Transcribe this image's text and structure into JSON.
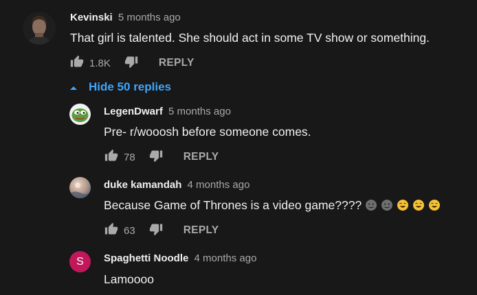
{
  "top_comment": {
    "author": "Kevinski",
    "time": "5 months ago",
    "text": "That girl is talented. She should act in some TV show or something.",
    "likes": "1.8K",
    "reply_label": "REPLY"
  },
  "replies_toggle": {
    "label": "Hide 50 replies"
  },
  "replies": [
    {
      "author": "LegenDwarf",
      "time": "5 months ago",
      "text": "Pre- r/wooosh before someone comes.",
      "likes": "78",
      "reply_label": "REPLY"
    },
    {
      "author": "duke kamandah",
      "time": "4 months ago",
      "text": "Because Game of Thrones is a video game????",
      "likes": "63",
      "reply_label": "REPLY"
    },
    {
      "author": "Spaghetti Noodle",
      "time": "4 months ago",
      "text": "Lamoooo",
      "avatar_letter": "S"
    }
  ],
  "colors": {
    "background": "#181818",
    "link_blue": "#3ea6ff",
    "secondary_text": "#aaaaaa",
    "avatar_pink": "#c2185b"
  }
}
